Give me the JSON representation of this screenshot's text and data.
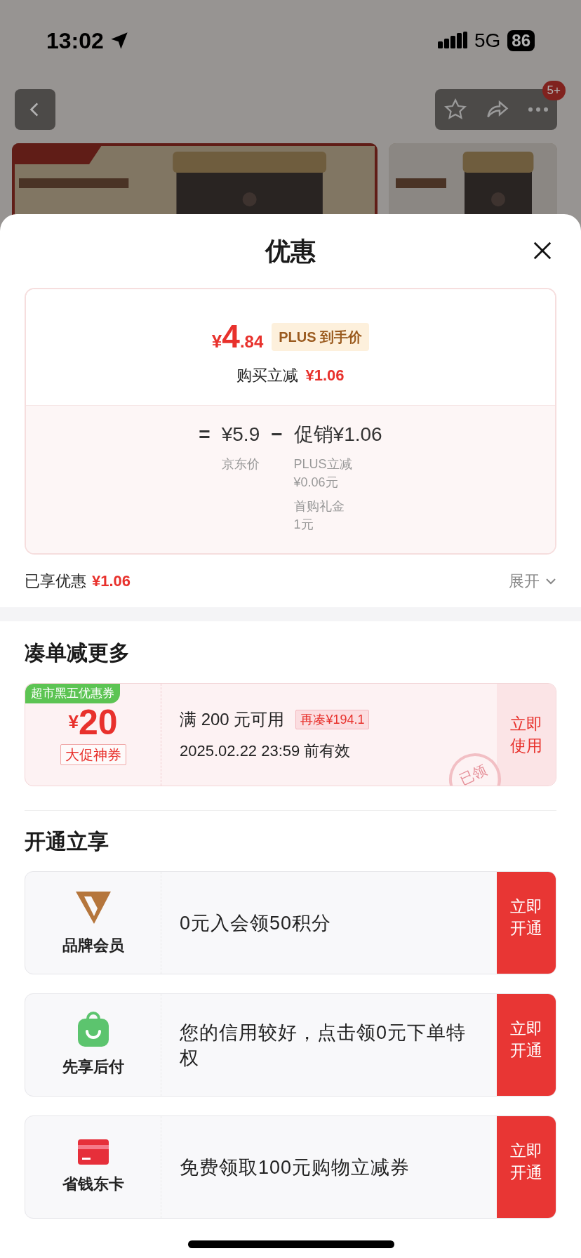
{
  "status_bar": {
    "time": "13:02",
    "network": "5G",
    "battery": "86"
  },
  "nav": {
    "badge": "5+"
  },
  "sheet": {
    "title": "优惠",
    "price_card": {
      "currency": "¥",
      "price_int": "4",
      "price_dec": ".84",
      "price_tag": "PLUS 到手价",
      "saving_label": "购买立减",
      "saving_value": "¥1.06",
      "equals": "=",
      "base_price": "¥5.9",
      "base_label": "京东价",
      "minus": "−",
      "promo": "促销¥1.06",
      "promo_details": [
        {
          "name": "PLUS立减",
          "amount": "¥0.06元"
        },
        {
          "name": "首购礼金",
          "amount": "1元"
        }
      ]
    },
    "enjoyed": {
      "label": "已享优惠",
      "value": "¥1.06",
      "expand": "展开"
    },
    "more_section": {
      "heading": "凑单减更多",
      "coupon": {
        "tag": "超市黑五优惠券",
        "currency": "¥",
        "amount": "20",
        "badge": "大促神券",
        "condition": "满 200 元可用",
        "hint": "再凑¥194.1",
        "expiry": "2025.02.22 23:59 前有效",
        "action": "立即使用",
        "stamp": "已领"
      }
    },
    "open_section": {
      "heading": "开通立享",
      "offers": [
        {
          "kind": "brand",
          "name": "品牌会员",
          "text": "0元入会领50积分",
          "action": "立即开通"
        },
        {
          "kind": "bag",
          "name": "先享后付",
          "text": "您的信用较好，点击领0元下单特权",
          "action": "立即开通"
        },
        {
          "kind": "card",
          "name": "省钱东卡",
          "text": "免费领取100元购物立减券",
          "action": "立即开通"
        }
      ]
    }
  }
}
